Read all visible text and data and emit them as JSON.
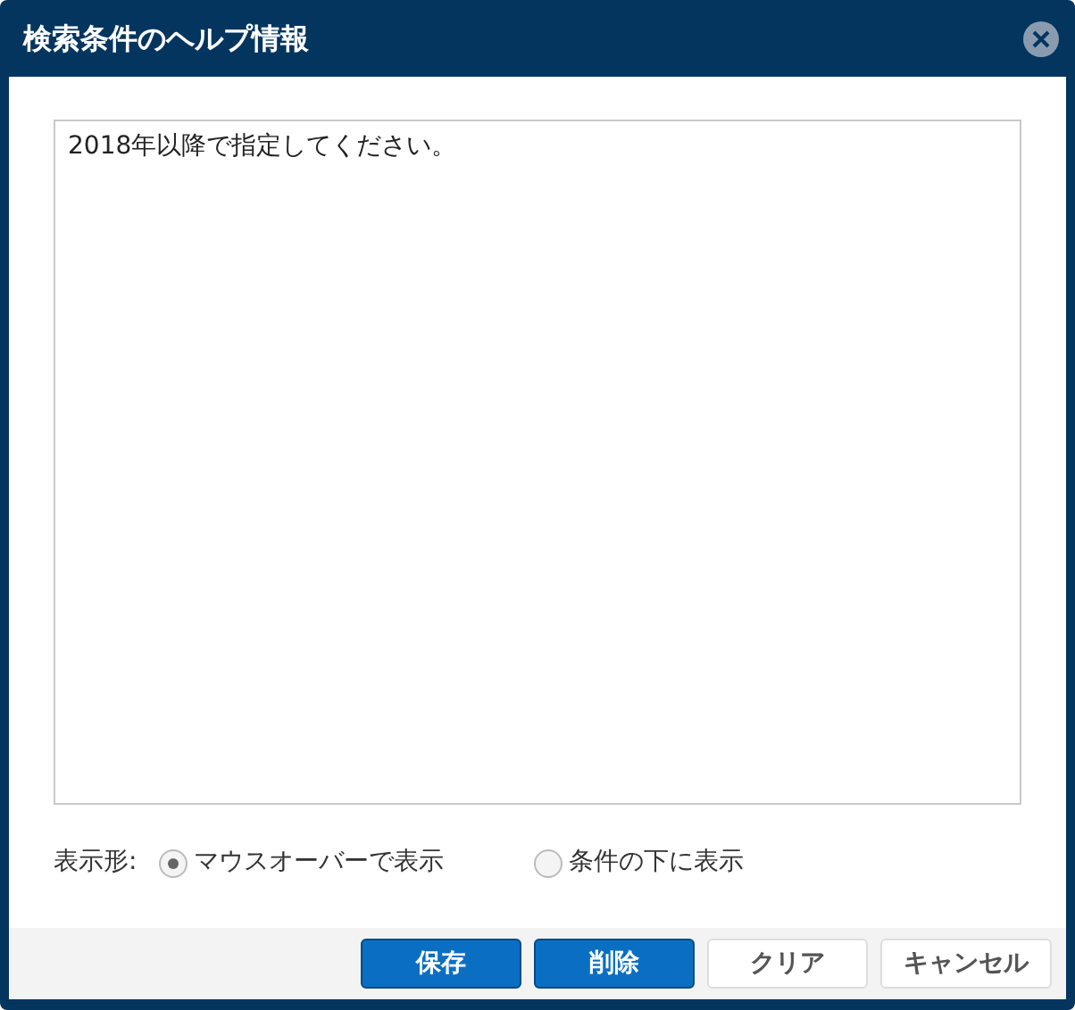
{
  "dialog": {
    "title": "検索条件のヘルプ情報"
  },
  "help_text": {
    "value": "2018年以降で指定してください。"
  },
  "display_format": {
    "label": "表示形:",
    "options": [
      {
        "label": "マウスオーバーで表示",
        "selected": true
      },
      {
        "label": "条件の下に表示",
        "selected": false
      }
    ]
  },
  "buttons": [
    {
      "label": "保存",
      "kind": "primary"
    },
    {
      "label": "削除",
      "kind": "primary"
    },
    {
      "label": "クリア",
      "kind": "secondary"
    },
    {
      "label": "キャンセル",
      "kind": "secondary"
    }
  ]
}
